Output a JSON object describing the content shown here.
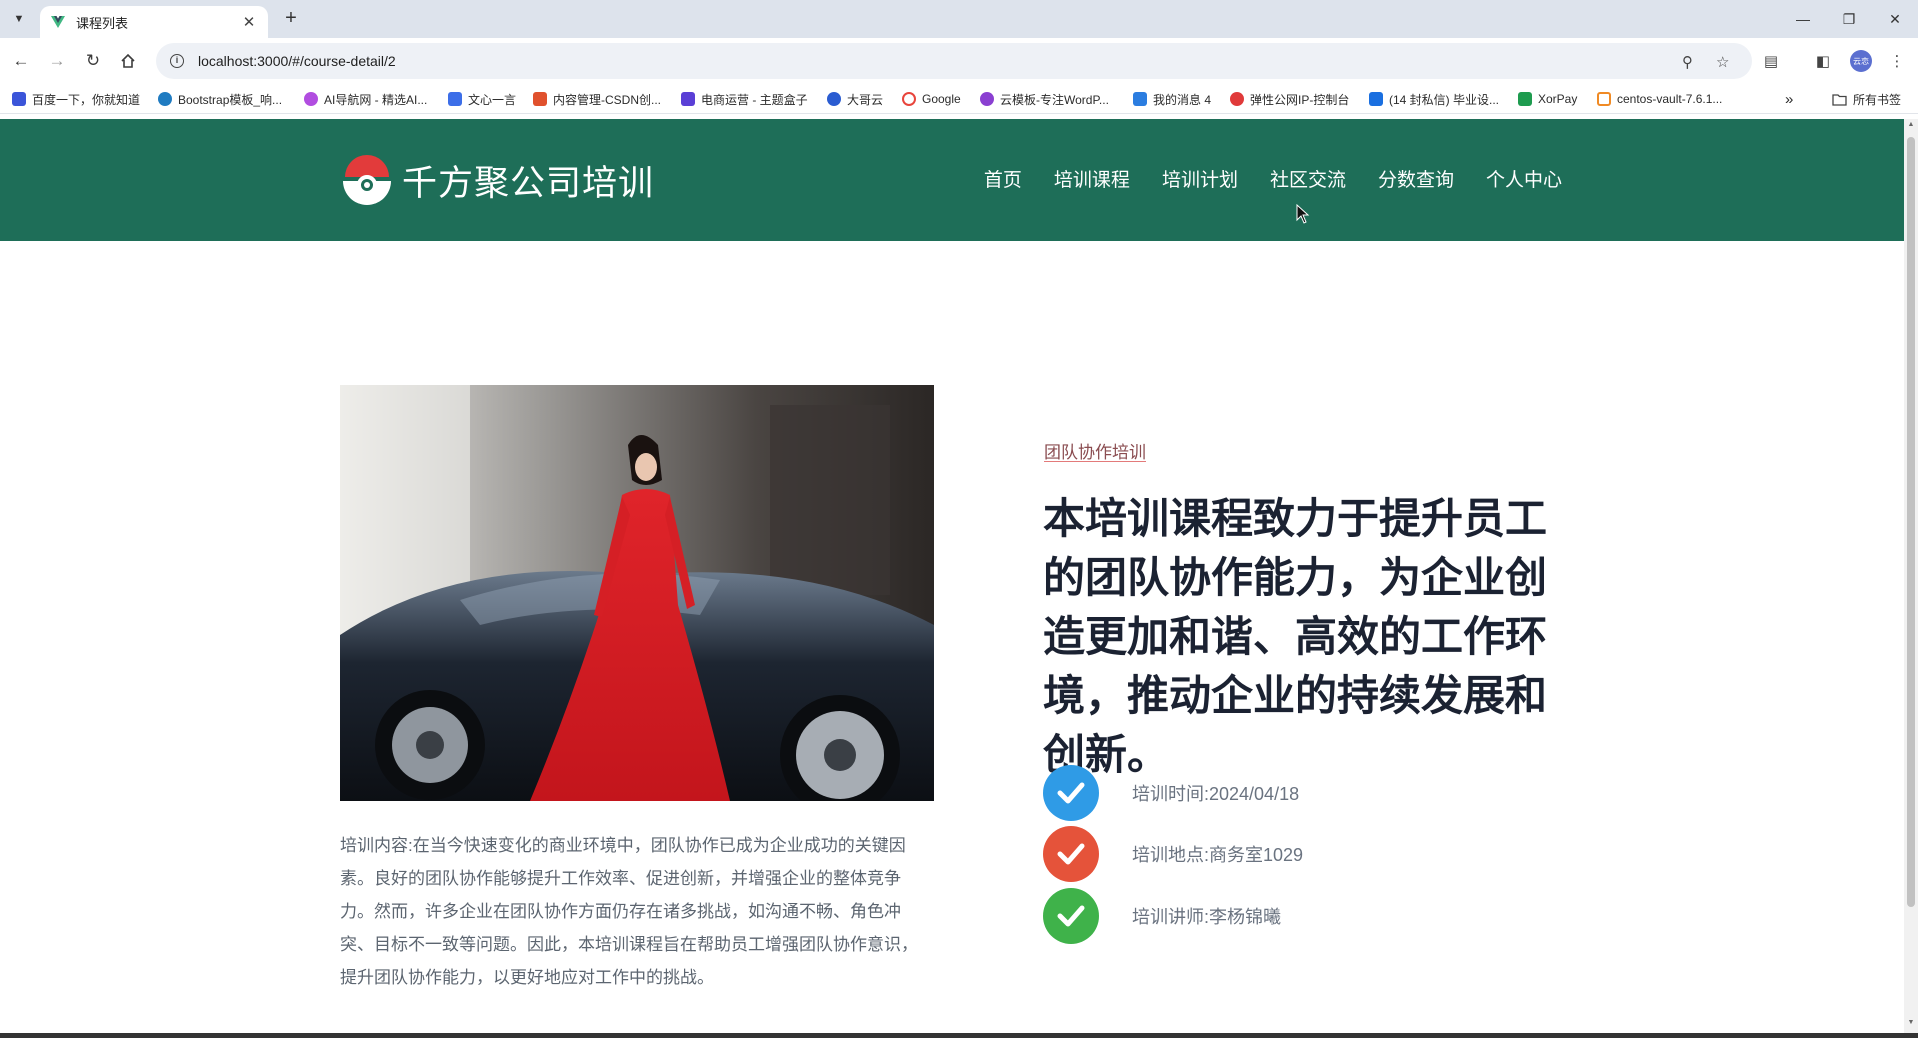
{
  "browser": {
    "tab_title": "课程列表",
    "url": "localhost:3000/#/course-detail/2",
    "profile_label": "云恋",
    "bookmarks": [
      {
        "label": "百度一下，你就知道",
        "color": "#3b55d9"
      },
      {
        "label": "Bootstrap模板_响...",
        "color": "#1f7bc1"
      },
      {
        "label": "AI导航网 - 精选AI...",
        "color": "#b14de0"
      },
      {
        "label": "文心一言",
        "color": "#3c6ee8"
      },
      {
        "label": "内容管理-CSDN创...",
        "color": "#e0512d"
      },
      {
        "label": "电商运营 - 主题盒子",
        "color": "#5a3fd6"
      },
      {
        "label": "大哥云",
        "color": "#2a5cd1"
      },
      {
        "label": "Google",
        "color": "#e8453c"
      },
      {
        "label": "云模板-专注WordP...",
        "color": "#8a3fd1"
      },
      {
        "label": "我的消息 4",
        "color": "#2b7de0"
      },
      {
        "label": "弹性公网IP-控制台",
        "color": "#e03a3a"
      },
      {
        "label": "(14 封私信) 毕业设...",
        "color": "#1a6fe0"
      },
      {
        "label": "XorPay",
        "color": "#1e9b4f"
      },
      {
        "label": "centos-vault-7.6.1...",
        "color": "#f08a24"
      }
    ],
    "all_bookmarks_label": "所有书签"
  },
  "site": {
    "logo_text": "千方聚公司培训",
    "nav": [
      "首页",
      "培训课程",
      "培训计划",
      "社区交流",
      "分数查询",
      "个人中心"
    ]
  },
  "course": {
    "tag": "团队协作培训",
    "headline": "本培训课程致力于提升员工的团队协作能力，为企业创造更加和谐、高效的工作环境，推动企业的持续发展和创新。",
    "description": "培训内容:在当今快速变化的商业环境中，团队协作已成为企业成功的关键因素。良好的团队协作能够提升工作效率、促进创新，并增强企业的整体竞争力。然而，许多企业在团队协作方面仍存在诸多挑战，如沟通不畅、角色冲突、目标不一致等问题。因此，本培训课程旨在帮助员工增强团队协作意识，提升团队协作能力，以更好地应对工作中的挑战。",
    "info": [
      {
        "text": "培训时间:2024/04/18",
        "color": "#2f9be6",
        "icon": "check-icon"
      },
      {
        "text": "培训地点:商务室1029",
        "color": "#e5533a",
        "icon": "check-icon"
      },
      {
        "text": "培训讲师:李杨锦曦",
        "color": "#3fb24a",
        "icon": "check-icon"
      }
    ]
  },
  "colors": {
    "header_bg": "#1e6e58",
    "tag_underline": "#e37a7a",
    "headline": "#1b2232"
  }
}
